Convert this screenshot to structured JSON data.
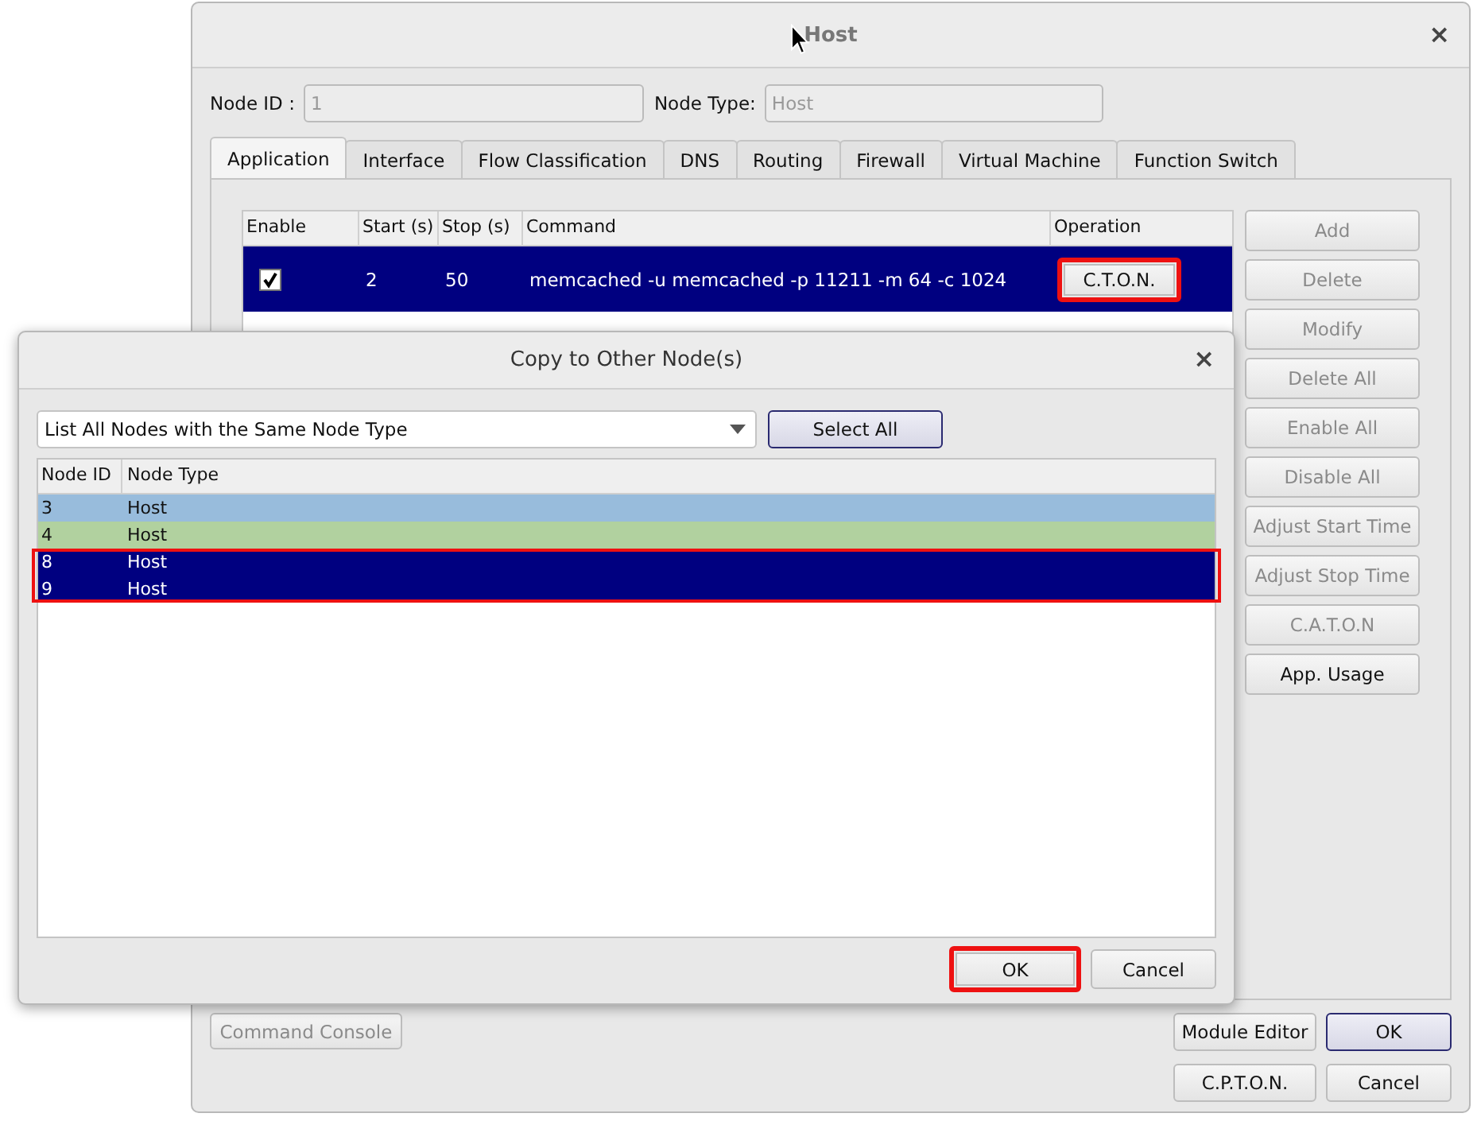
{
  "main_window": {
    "title": "Host",
    "close": "×",
    "node_id": {
      "label": "Node ID :",
      "value": "1",
      "disabled": true
    },
    "node_type": {
      "label": "Node Type:",
      "value": "Host",
      "disabled": true
    },
    "tabs": [
      {
        "label": "Application",
        "selected": true
      },
      {
        "label": "Interface",
        "selected": false
      },
      {
        "label": "Flow Classification",
        "selected": false
      },
      {
        "label": "DNS",
        "selected": false
      },
      {
        "label": "Routing",
        "selected": false
      },
      {
        "label": "Firewall",
        "selected": false
      },
      {
        "label": "Virtual Machine",
        "selected": false
      },
      {
        "label": "Function Switch",
        "selected": false
      }
    ],
    "table": {
      "columns": [
        "Enable",
        "Start (s)",
        "Stop (s)",
        "Command",
        "Operation"
      ],
      "rows": [
        {
          "enabled": true,
          "start": "2",
          "stop": "50",
          "command": "memcached -u memcached -p 11211 -m 64 -c 1024",
          "operation": "C.T.O.N.",
          "highlighted": true,
          "selected": true
        }
      ]
    },
    "side_buttons": [
      {
        "label": "Add",
        "disabled": true
      },
      {
        "label": "Delete",
        "disabled": true
      },
      {
        "label": "Modify",
        "disabled": true
      },
      {
        "label": "Delete All",
        "disabled": true
      },
      {
        "label": "Enable All",
        "disabled": true
      },
      {
        "label": "Disable All",
        "disabled": true
      },
      {
        "label": "Adjust Start Time",
        "disabled": true
      },
      {
        "label": "Adjust Stop Time",
        "disabled": true
      },
      {
        "label": "C.A.T.O.N",
        "disabled": true
      },
      {
        "label": "App. Usage",
        "disabled": false
      }
    ],
    "command_console": {
      "label": "Command  Console",
      "disabled": true
    },
    "bottom_buttons": [
      {
        "label": "Module Editor",
        "default": false
      },
      {
        "label": "OK",
        "default": true
      },
      {
        "label": "C.P.T.O.N.",
        "default": false
      },
      {
        "label": "Cancel",
        "default": false
      }
    ]
  },
  "dialog": {
    "title": "Copy to Other Node(s)",
    "close": "×",
    "filter": {
      "value": "List All Nodes with the Same Node Type"
    },
    "select_all": {
      "label": "Select All",
      "default": true
    },
    "columns": [
      "Node ID",
      "Node Type"
    ],
    "rows": [
      {
        "id": "3",
        "type": "Host",
        "selected": false,
        "color": "#98bcdc",
        "highlighted": false
      },
      {
        "id": "4",
        "type": "Host",
        "selected": false,
        "color": "#b1d19f",
        "highlighted": false
      },
      {
        "id": "8",
        "type": "Host",
        "selected": true,
        "color": "#000080",
        "highlighted": true
      },
      {
        "id": "9",
        "type": "Host",
        "selected": true,
        "color": "#000080",
        "highlighted": true
      }
    ],
    "buttons": [
      {
        "label": "OK",
        "highlighted": true
      },
      {
        "label": "Cancel",
        "highlighted": false
      }
    ]
  }
}
